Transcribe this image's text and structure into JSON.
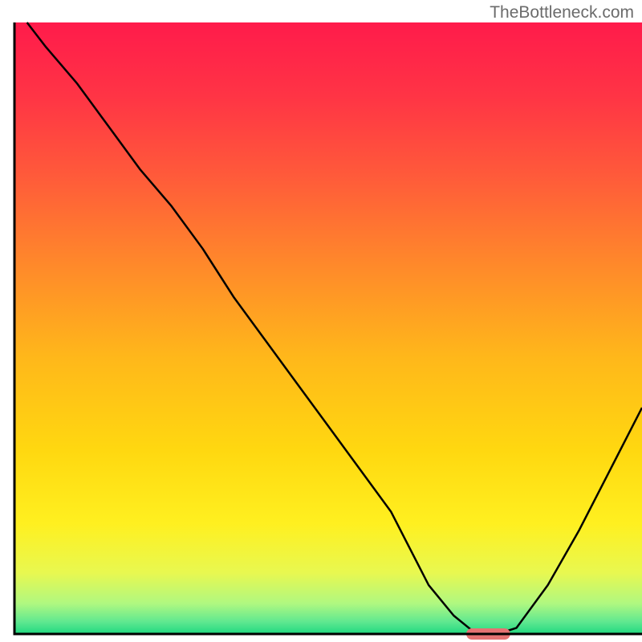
{
  "watermark": "TheBottleneck.com",
  "chart_data": {
    "type": "line",
    "title": "",
    "xlabel": "",
    "ylabel": "",
    "xlim": [
      0,
      100
    ],
    "ylim": [
      0,
      100
    ],
    "x": [
      2,
      5,
      10,
      15,
      20,
      25,
      30,
      35,
      40,
      45,
      50,
      55,
      60,
      63,
      66,
      70,
      73,
      75,
      77,
      80,
      85,
      90,
      95,
      100
    ],
    "values": [
      100,
      96,
      90,
      83,
      76,
      70,
      63,
      55,
      48,
      41,
      34,
      27,
      20,
      14,
      8,
      3,
      0.5,
      0,
      0,
      1,
      8,
      17,
      27,
      37
    ],
    "optimal_marker": {
      "x_start": 72,
      "x_end": 79,
      "y": 0
    },
    "gradient_stops": [
      {
        "offset": 0,
        "color": "#ff1b4b"
      },
      {
        "offset": 0.12,
        "color": "#ff3445"
      },
      {
        "offset": 0.25,
        "color": "#ff5a3a"
      },
      {
        "offset": 0.4,
        "color": "#ff8a2a"
      },
      {
        "offset": 0.55,
        "color": "#ffb81a"
      },
      {
        "offset": 0.7,
        "color": "#ffd810"
      },
      {
        "offset": 0.82,
        "color": "#fff020"
      },
      {
        "offset": 0.9,
        "color": "#e8f850"
      },
      {
        "offset": 0.95,
        "color": "#b0f880"
      },
      {
        "offset": 0.98,
        "color": "#60e890"
      },
      {
        "offset": 1.0,
        "color": "#20d880"
      }
    ]
  }
}
